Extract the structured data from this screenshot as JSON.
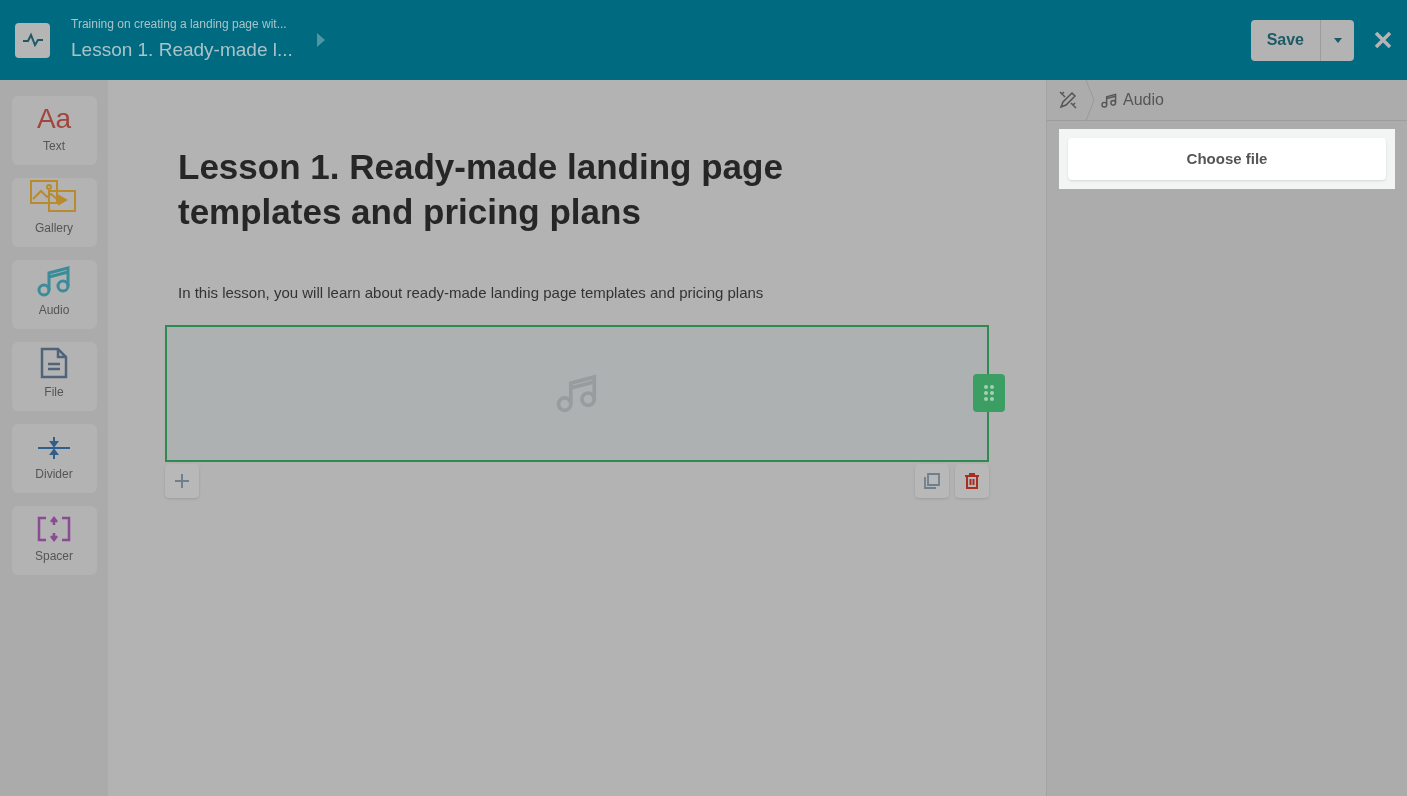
{
  "header": {
    "course": "Training on creating a landing page wit...",
    "lesson": "Lesson 1. Ready-made l...",
    "save": "Save"
  },
  "tools": [
    {
      "kind": "text",
      "label": "Text",
      "glyph": "Aa",
      "color": "#a1463c"
    },
    {
      "kind": "gallery",
      "label": "Gallery",
      "color": "#b98a2e"
    },
    {
      "kind": "audio",
      "label": "Audio",
      "color": "#3a8c9a"
    },
    {
      "kind": "file",
      "label": "File",
      "color": "#4f6478"
    },
    {
      "kind": "divider",
      "label": "Divider",
      "color": "#2f5f8c"
    },
    {
      "kind": "spacer",
      "label": "Spacer",
      "color": "#8a4a94"
    }
  ],
  "content": {
    "title": "Lesson 1. Ready-made landing page templates and pricing plans",
    "intro": "In this lesson, you will learn about ready-made landing page templates and pricing plans"
  },
  "panel": {
    "breadcrumb": "Audio",
    "choose": "Choose file"
  }
}
